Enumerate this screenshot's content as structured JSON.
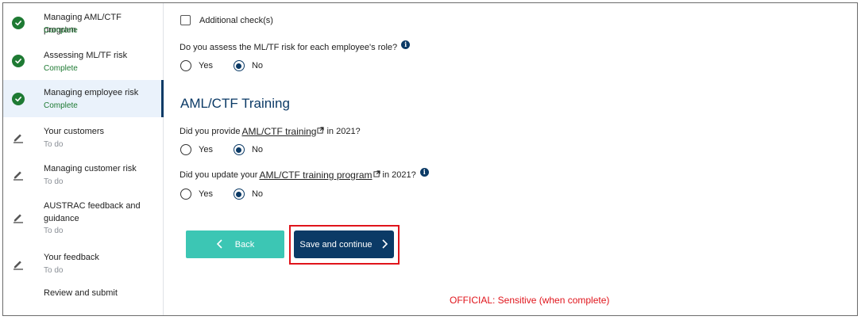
{
  "sidebar": {
    "items": [
      {
        "title": "Managing AML/CTF program",
        "status": "Complete",
        "state": "complete",
        "icon": "check-circle-icon"
      },
      {
        "title": "Assessing ML/TF risk",
        "status": "Complete",
        "state": "complete",
        "icon": "check-circle-icon"
      },
      {
        "title": "Managing employee risk",
        "status": "Complete",
        "state": "complete",
        "icon": "check-circle-icon",
        "active": true
      },
      {
        "title": "Your customers",
        "status": "To do",
        "state": "todo",
        "icon": "pencil-icon"
      },
      {
        "title": "Managing customer risk",
        "status": "To do",
        "state": "todo",
        "icon": "pencil-icon"
      },
      {
        "title": "AUSTRAC feedback and guidance",
        "status": "To do",
        "state": "todo",
        "icon": "pencil-icon"
      },
      {
        "title": "Your feedback",
        "status": "To do",
        "state": "todo",
        "icon": "pencil-icon"
      },
      {
        "title": "Review and submit",
        "status": "",
        "state": "none",
        "icon": ""
      }
    ]
  },
  "main": {
    "additional_checks_label": "Additional check(s)",
    "q_role_risk": {
      "text": "Do you assess the ML/TF risk for each employee's role?",
      "options": [
        "Yes",
        "No"
      ],
      "selected": "No"
    },
    "section_heading": "AML/CTF Training",
    "q_training": {
      "prefix": "Did you provide",
      "link": "AML/CTF training",
      "suffix": "in 2021?",
      "options": [
        "Yes",
        "No"
      ],
      "selected": "No"
    },
    "q_program": {
      "prefix": "Did you update your",
      "link": "AML/CTF training program",
      "suffix": "in 2021?",
      "options": [
        "Yes",
        "No"
      ],
      "selected": "No"
    },
    "back_label": "Back",
    "save_label": "Save and continue",
    "classification": "OFFICIAL: Sensitive (when complete)"
  },
  "colors": {
    "primary": "#0b3a66",
    "teal": "#3cc6b4",
    "complete_green": "#1e7a33",
    "highlight_red": "#e0141b"
  }
}
